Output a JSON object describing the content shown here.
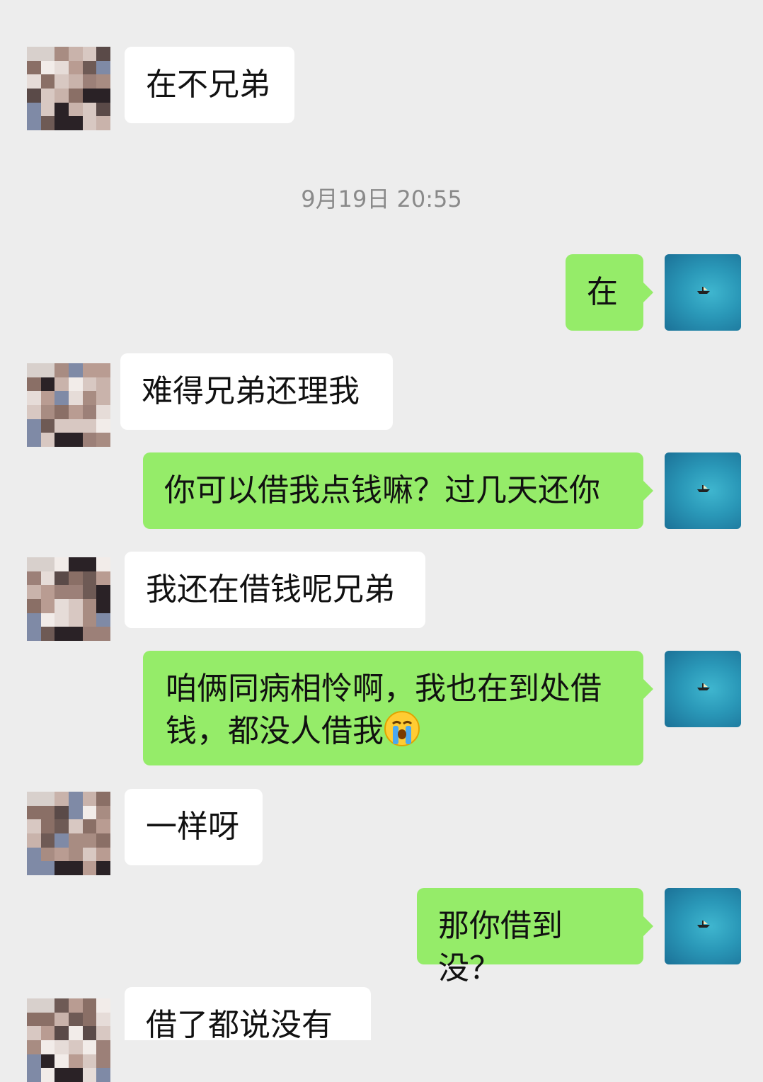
{
  "timestamp": "9月19日 20:55",
  "messages": [
    {
      "side": "left",
      "text": "在不兄弟"
    },
    {
      "side": "right",
      "text": "在"
    },
    {
      "side": "left",
      "text": "难得兄弟还理我"
    },
    {
      "side": "right",
      "text": "你可以借我点钱嘛？过几天还你"
    },
    {
      "side": "left",
      "text": "我还在借钱呢兄弟"
    },
    {
      "side": "right",
      "text": "咱俩同病相怜啊，我也在到处借钱，都没人借我"
    },
    {
      "side": "left",
      "text": "一样呀"
    },
    {
      "side": "right",
      "text": "那你借到没？"
    },
    {
      "side": "left",
      "text": "借了都说没有"
    }
  ],
  "colors": {
    "background": "#ededed",
    "bubble_right": "#95ec69",
    "bubble_left": "#ffffff",
    "timestamp": "#8a8a8a"
  },
  "icons": {
    "emoji": "loudly-crying-face-icon",
    "self_avatar": "sea-boat-avatar"
  }
}
